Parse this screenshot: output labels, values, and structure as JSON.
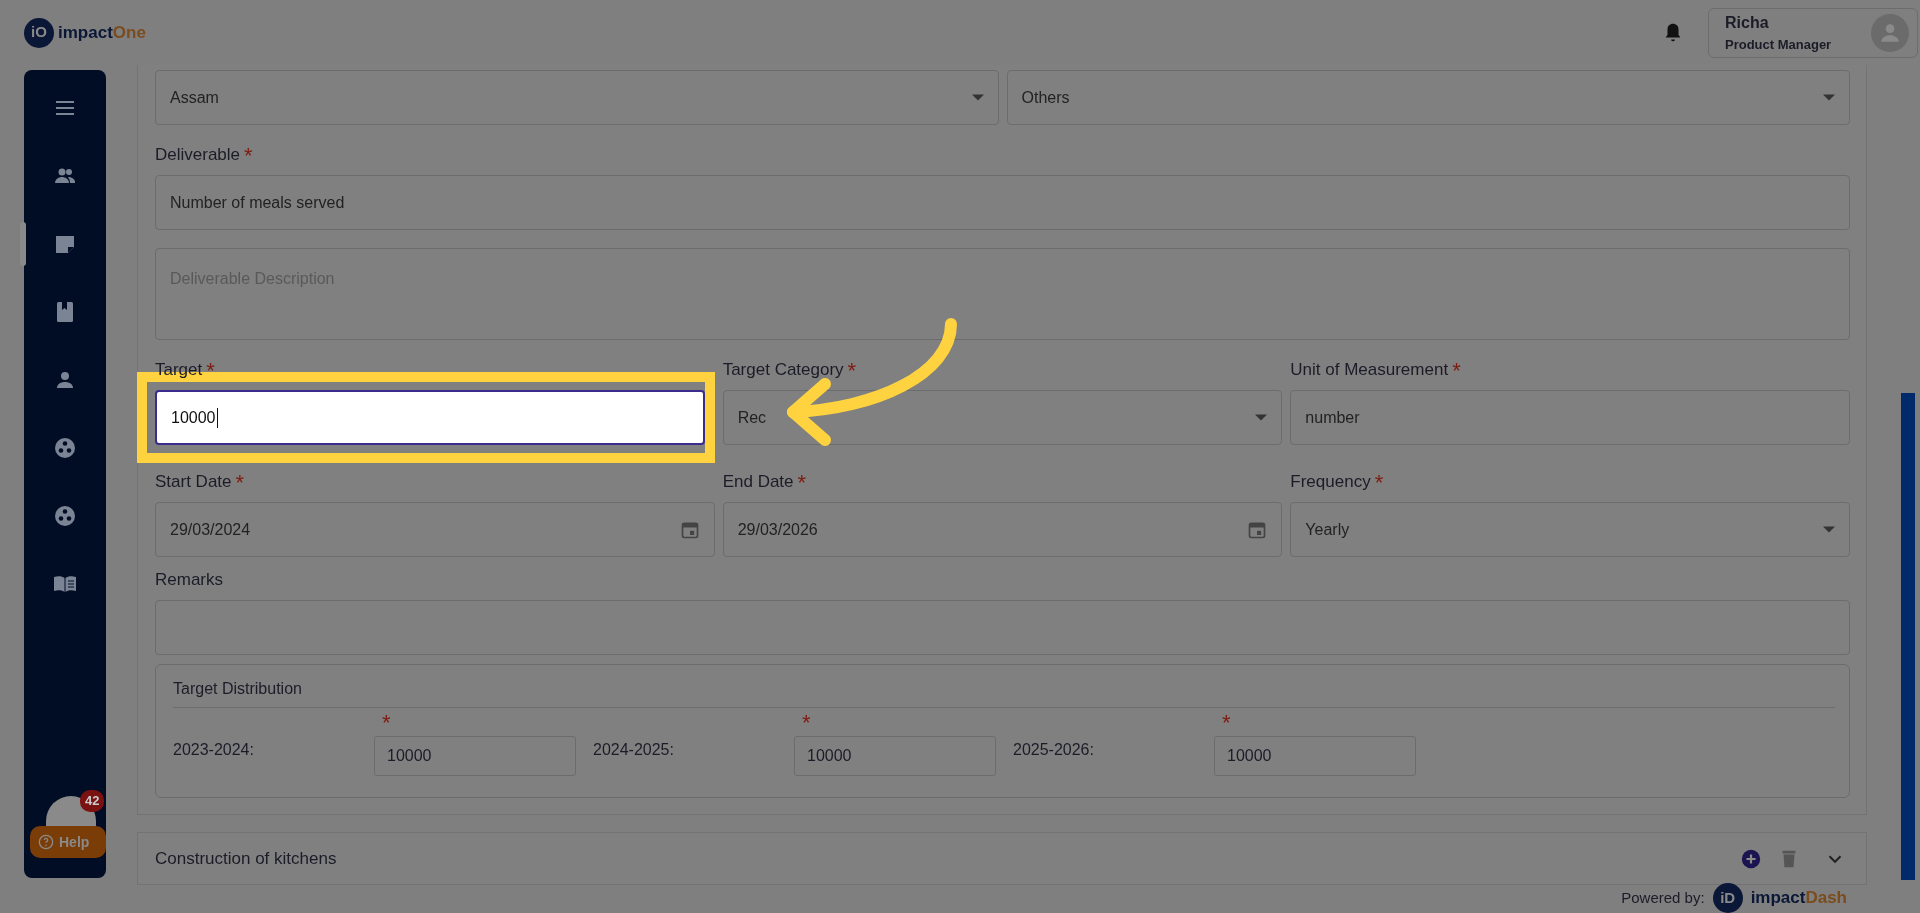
{
  "header": {
    "logo": {
      "mark": "iO",
      "name": "impact",
      "accent": "One"
    },
    "user": {
      "name": "Richa",
      "role": "Product Manager"
    }
  },
  "sidebar": {
    "items": [
      {
        "selected": false
      },
      {
        "selected": false
      },
      {
        "selected": true
      },
      {
        "selected": false
      },
      {
        "selected": false
      },
      {
        "selected": false
      },
      {
        "selected": false
      },
      {
        "selected": false
      }
    ],
    "help": {
      "badge": "42",
      "label": "Help"
    }
  },
  "form": {
    "rows": [
      [
        {
          "kind": "select",
          "value": "Assam"
        },
        {
          "kind": "select",
          "value": "Others"
        }
      ],
      [
        {
          "kind": "input",
          "label": "Deliverable",
          "required_mark": "*",
          "value": "Number of meals served"
        }
      ],
      [
        {
          "kind": "textarea",
          "placeholder": "Deliverable Description"
        }
      ],
      [
        {
          "kind": "input",
          "label": "Target",
          "required_mark": "*",
          "value": "10000",
          "highlighted": true
        },
        {
          "kind": "select",
          "label": "Target Category",
          "required_mark": "*",
          "value": "Rec"
        },
        {
          "kind": "input",
          "label": "Unit of Measurement",
          "required_mark": "*",
          "value": "number"
        }
      ],
      [
        {
          "kind": "date",
          "label": "Start Date",
          "required_mark": "*",
          "value": "29/03/2024"
        },
        {
          "kind": "date",
          "label": "End Date",
          "required_mark": "*",
          "value": "29/03/2026"
        },
        {
          "kind": "select",
          "label": "Frequency",
          "required_mark": "*",
          "value": "Yearly"
        }
      ],
      [
        {
          "kind": "input",
          "label": "Remarks"
        }
      ]
    ],
    "target_distribution": {
      "title": "Target Distribution",
      "years": [
        {
          "label": "2023-2024:",
          "required_mark": "*",
          "value": "10000"
        },
        {
          "label": "2024-2025:",
          "required_mark": "*",
          "value": "10000"
        },
        {
          "label": "2025-2026:",
          "required_mark": "*",
          "value": "10000"
        }
      ]
    }
  },
  "sections": [
    {
      "title": "Construction of kitchens",
      "expanded": false
    }
  ],
  "footer": {
    "label": "Powered by:",
    "mark": "iD",
    "name": "impact",
    "accent": "Dash"
  }
}
